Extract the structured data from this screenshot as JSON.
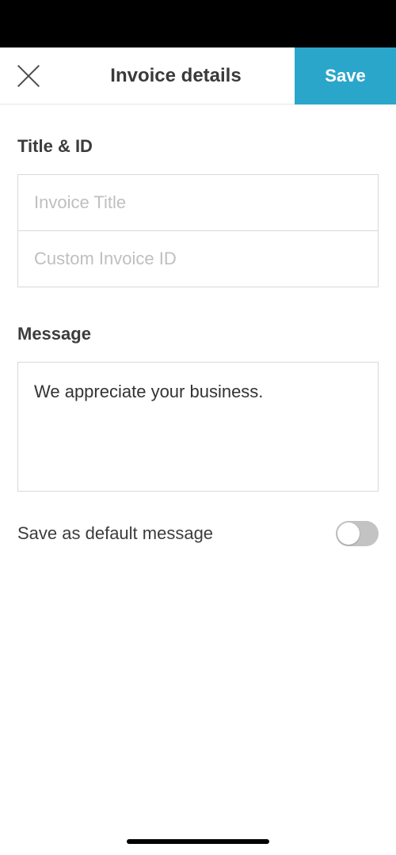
{
  "header": {
    "title": "Invoice details",
    "save_label": "Save"
  },
  "sections": {
    "title_id": {
      "label": "Title & ID",
      "fields": {
        "invoice_title_placeholder": "Invoice Title",
        "invoice_title_value": "",
        "custom_id_placeholder": "Custom Invoice ID",
        "custom_id_value": ""
      }
    },
    "message": {
      "label": "Message",
      "value": "We appreciate your business.",
      "toggle": {
        "label": "Save as default message",
        "state": "off"
      }
    }
  }
}
